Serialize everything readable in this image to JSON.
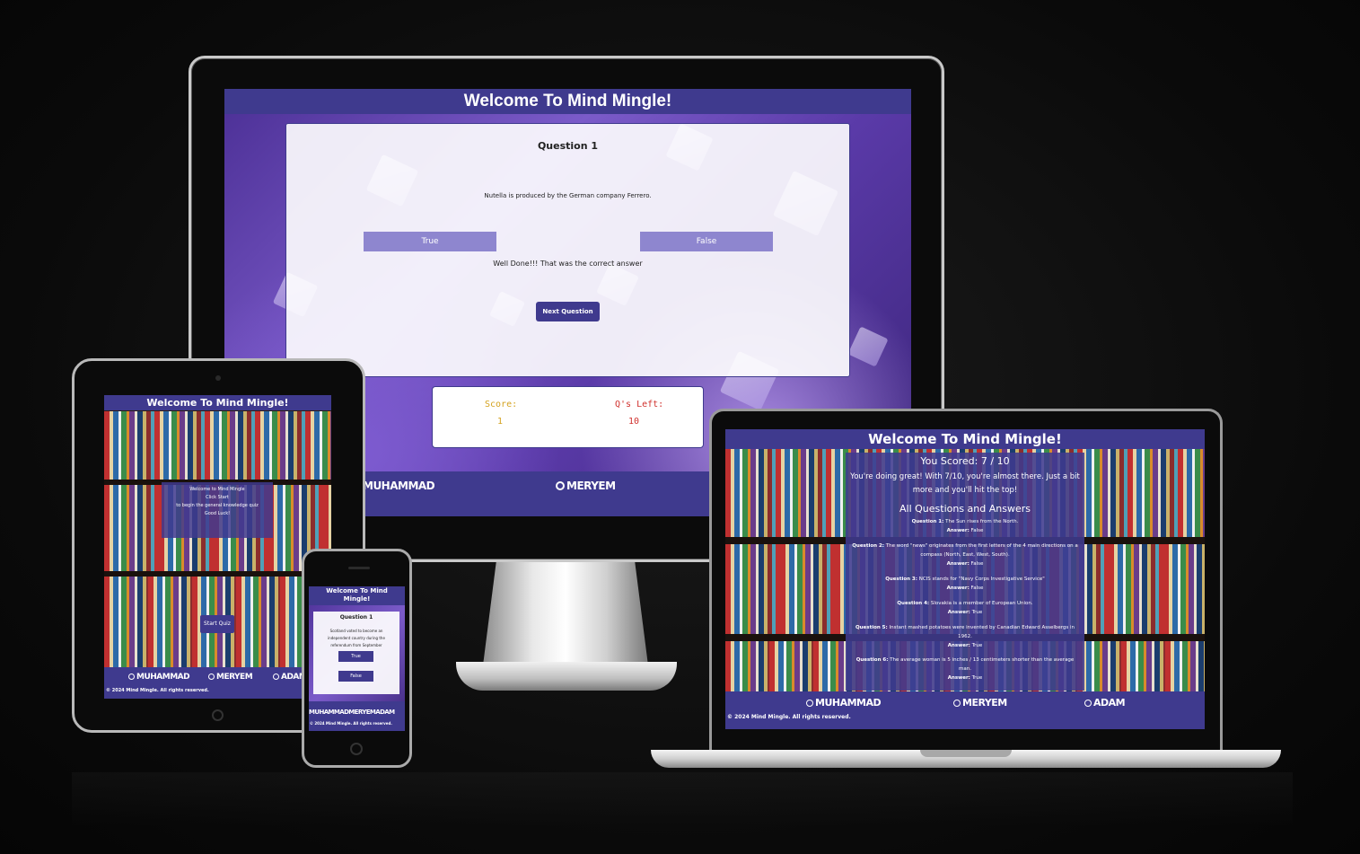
{
  "colors": {
    "primary": "#3f3a8e",
    "answer_button": "#8e86cf",
    "score": "#d4a21f",
    "questions_left": "#d0312d",
    "background": "#0a0a0a"
  },
  "desktop": {
    "header_title": "Welcome To Mind Mingle!",
    "question_title": "Question 1",
    "question_text": "Nutella is produced by the German company Ferrero.",
    "true_label": "True",
    "false_label": "False",
    "feedback": "Well Done!!! That was the correct answer",
    "next_label": "Next Question",
    "score_label": "Score:",
    "score_value": "1",
    "qleft_label": "Q's Left:",
    "qleft_value": "10",
    "footer": {
      "link1": "MUHAMMAD",
      "link2": "MERYEM"
    }
  },
  "tablet": {
    "header_title": "Welcome To Mind Mingle!",
    "welcome_lines": [
      "Welcome to Mind Mingle",
      "Click Start",
      "to begin the general knowledge quiz",
      "Good Luck!"
    ],
    "start_label": "Start Quiz",
    "footer": {
      "link1": "MUHAMMAD",
      "link2": "MERYEM",
      "link3": "ADAM",
      "copyright": "© 2024 Mind Mingle. All rights reserved."
    }
  },
  "phone": {
    "header_line1": "Welcome To Mind",
    "header_line2": "Mingle!",
    "question_title": "Question 1",
    "question_text": "Scotland voted to become an independent country during the referendum from September",
    "true_label": "True",
    "false_label": "False",
    "footer": {
      "links": "MUHAMMADMERYEMADAM",
      "copyright": "© 2024 Mind Mingle. All rights reserved."
    }
  },
  "laptop": {
    "header_title": "Welcome To Mind Mingle!",
    "score_text": "You Scored: 7 / 10",
    "message_line1": "You're doing great! With 7/10, you're almost there. Just a bit",
    "message_line2": "more and you'll hit the top!",
    "all_qa_title": "All Questions and Answers",
    "answer_label": "Answer:",
    "questions": [
      {
        "label": "Question 1:",
        "text": "The Sun rises from the North.",
        "answer": "False"
      },
      {
        "label": "Question 2:",
        "text": "The word \"news\" originates from the first letters of the 4 main directions on a",
        "text2": "compass (North, East, West, South).",
        "answer": "False"
      },
      {
        "label": "Question 3:",
        "text": "NCIS stands for \"Navy Corps Investigative Service\"",
        "answer": "False"
      },
      {
        "label": "Question 4:",
        "text": "Slovakia is a member of European Union.",
        "answer": "True"
      },
      {
        "label": "Question 5:",
        "text": "Instant mashed potatoes were invented by Canadian Edward Asselbergs in",
        "text2": "1962.",
        "answer": "True"
      },
      {
        "label": "Question 6:",
        "text": "The average woman is 5 inches / 13 centimeters shorter than the average",
        "text2": "man.",
        "answer": "True"
      }
    ],
    "footer": {
      "link1": "MUHAMMAD",
      "link2": "MERYEM",
      "link3": "ADAM",
      "copyright": "© 2024 Mind Mingle. All rights reserved."
    }
  }
}
